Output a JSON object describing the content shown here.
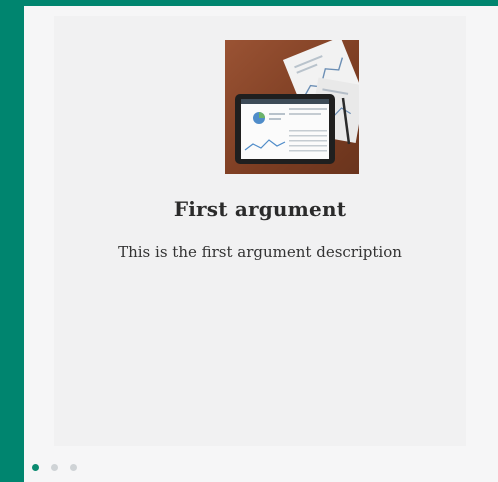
{
  "slide": {
    "title": "First argument",
    "description": "This is the first argument description",
    "image_icon": "dashboard-tablet-photo"
  },
  "carousel": {
    "count": 3,
    "active_index": 0
  },
  "colors": {
    "frame": "#00856f",
    "card": "#f1f1f2",
    "active_dot": "#0a8a70",
    "inactive_dot": "#cfd3d6"
  }
}
